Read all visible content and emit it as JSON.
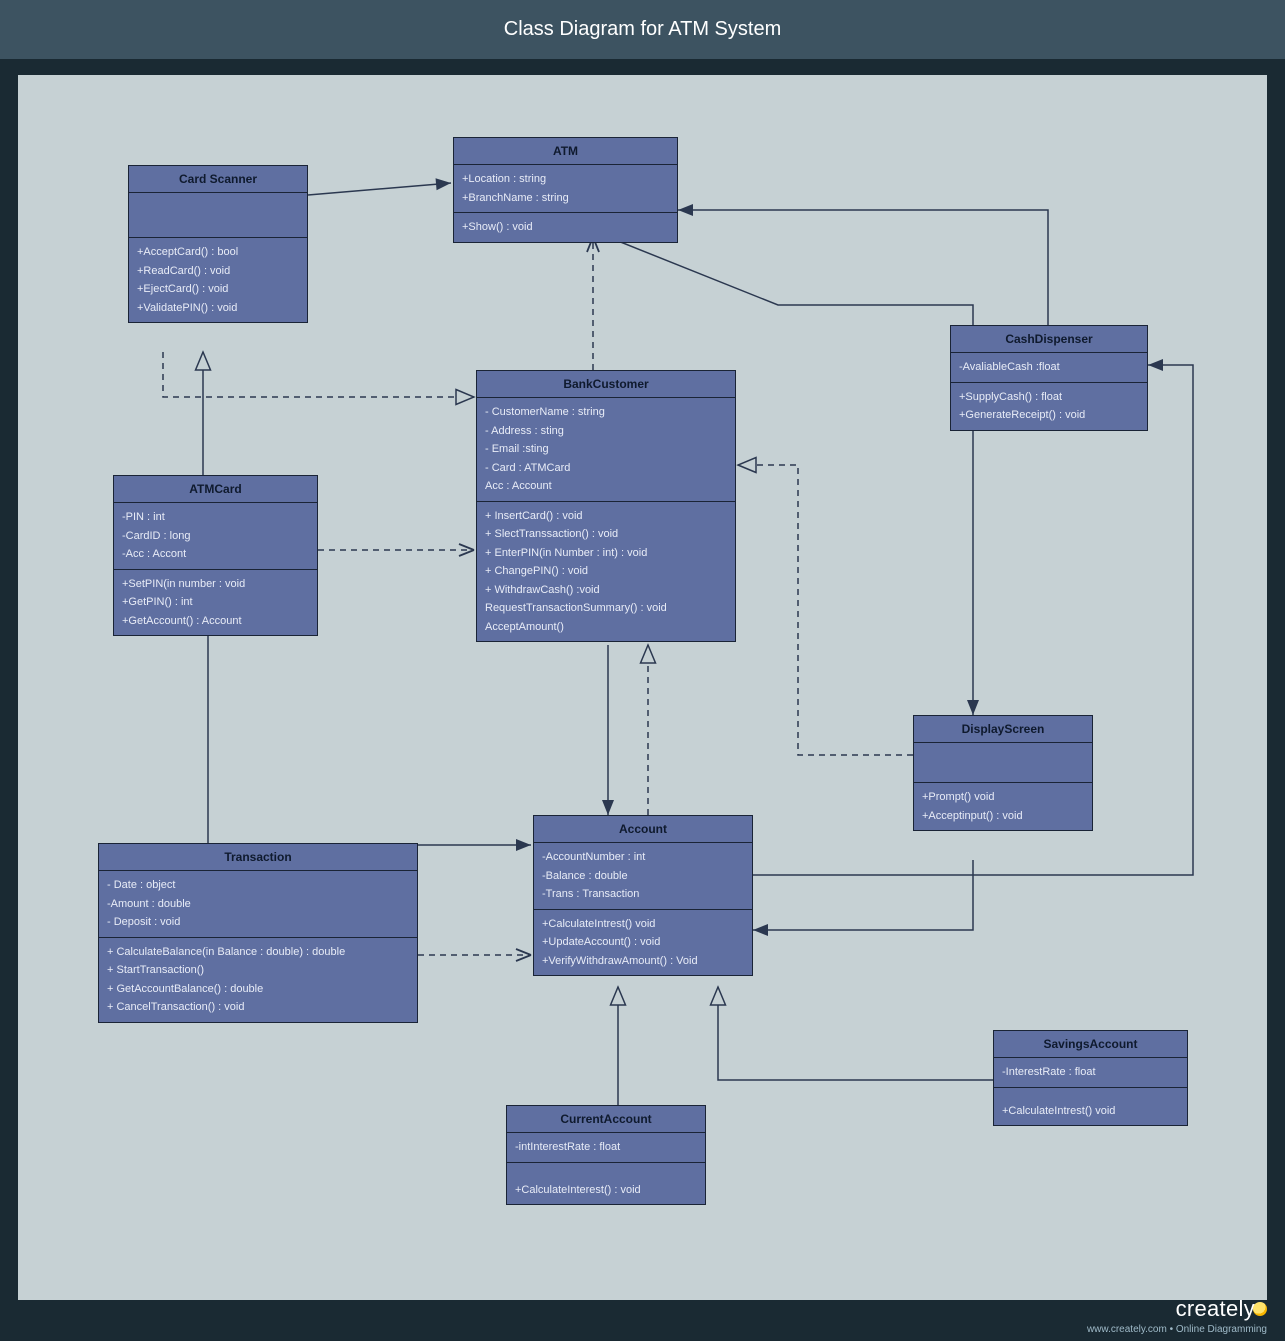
{
  "title": "Class Diagram for ATM System",
  "footer": {
    "brand": "creately",
    "tagline": "www.creately.com • Online Diagramming"
  },
  "classes": {
    "cardScanner": {
      "name": "Card Scanner",
      "attrs": [],
      "ops": [
        "+AcceptCard() : bool",
        "+ReadCard() : void",
        "+EjectCard() : void",
        "+ValidatePIN() : void"
      ]
    },
    "atm": {
      "name": "ATM",
      "attrs": [
        "+Location : string",
        "+BranchName : string"
      ],
      "ops": [
        "+Show() : void"
      ]
    },
    "atmCard": {
      "name": "ATMCard",
      "attrs": [
        "-PIN : int",
        "-CardID : long",
        "-Acc : Accont"
      ],
      "ops": [
        "+SetPIN(in number : void",
        "+GetPIN() : int",
        "+GetAccount() : Account"
      ]
    },
    "bankCustomer": {
      "name": "BankCustomer",
      "attrs": [
        "- CustomerName : string",
        "- Address : sting",
        "- Email :sting",
        "- Card : ATMCard",
        "Acc : Account"
      ],
      "ops": [
        "+ InsertCard() : void",
        "+ SlectTranssaction() : void",
        "+ EnterPIN(in Number : int) : void",
        "+ ChangePIN() : void",
        "+ WithdrawCash() :void",
        "RequestTransactionSummary() : void",
        "AcceptAmount()"
      ]
    },
    "cashDispenser": {
      "name": "CashDispenser",
      "attrs": [
        "-AvaliableCash :float"
      ],
      "ops": [
        "+SupplyCash() : float",
        "+GenerateReceipt() : void"
      ]
    },
    "displayScreen": {
      "name": "DisplayScreen",
      "attrs": [],
      "ops": [
        "+Prompt() void",
        "+Acceptinput() : void"
      ]
    },
    "transaction": {
      "name": "Transaction",
      "attrs": [
        "- Date : object",
        "-Amount : double",
        "- Deposit : void"
      ],
      "ops": [
        "+ CalculateBalance(in Balance : double) : double",
        "+ StartTransaction()",
        "+ GetAccountBalance() : double",
        "+ CancelTransaction() : void"
      ]
    },
    "account": {
      "name": "Account",
      "attrs": [
        "-AccountNumber : int",
        "-Balance : double",
        "-Trans : Transaction"
      ],
      "ops": [
        "+CalculateIntrest() void",
        "+UpdateAccount() : void",
        "+VerifyWithdrawAmount() : Void"
      ]
    },
    "currentAccount": {
      "name": "CurrentAccount",
      "attrs": [
        "-intInterestRate : float"
      ],
      "ops": [
        "+CalculateInterest() : void"
      ]
    },
    "savingsAccount": {
      "name": "SavingsAccount",
      "attrs": [
        "-InterestRate : float"
      ],
      "ops": [
        "+CalculateIntrest() void"
      ]
    }
  }
}
